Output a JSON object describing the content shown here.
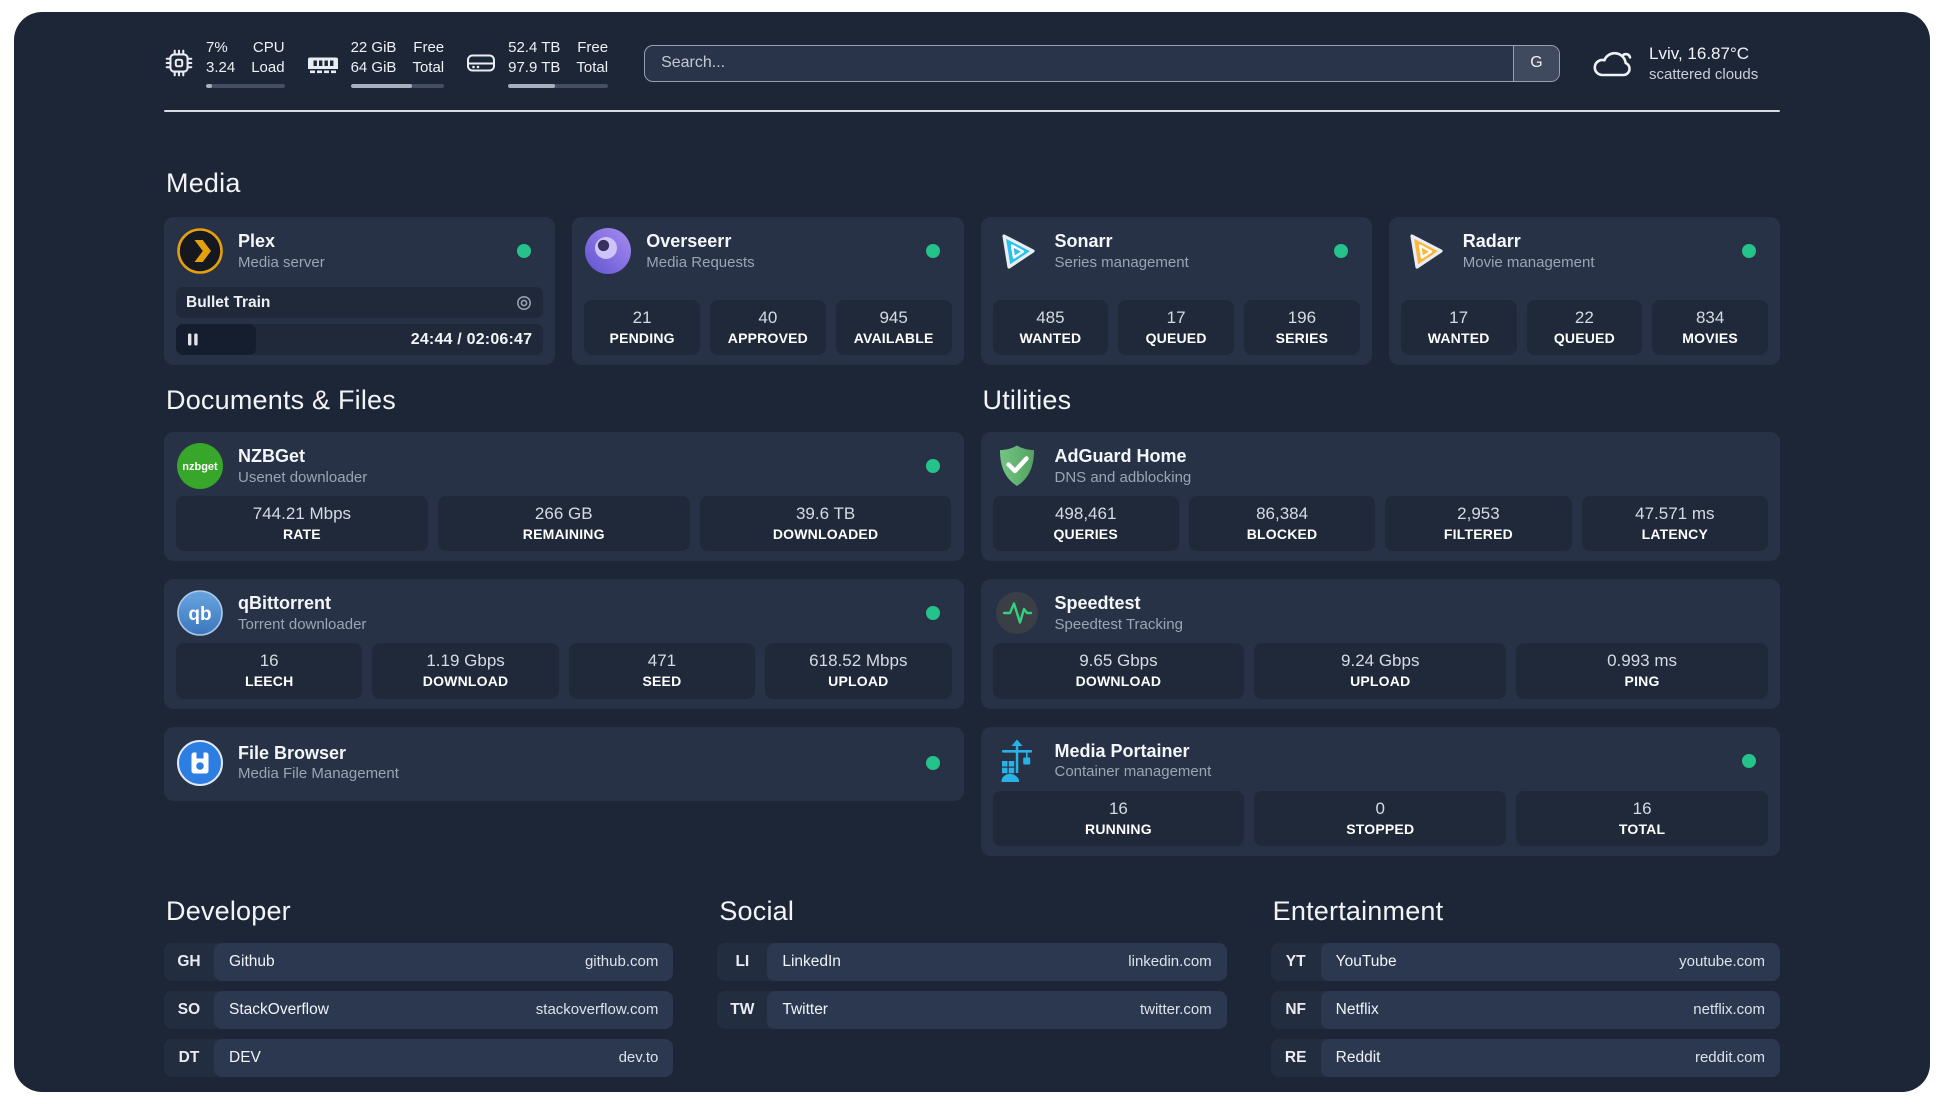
{
  "header": {
    "stats": [
      {
        "values": [
          "7%",
          "3.24"
        ],
        "labels": [
          "CPU",
          "Load"
        ],
        "progress": 8
      },
      {
        "values": [
          "22 GiB",
          "64 GiB"
        ],
        "labels": [
          "Free",
          "Total"
        ],
        "progress": 66
      },
      {
        "values": [
          "52.4 TB",
          "97.9 TB"
        ],
        "labels": [
          "Free",
          "Total"
        ],
        "progress": 47
      }
    ],
    "search": {
      "placeholder": "Search...",
      "button_label": "G"
    },
    "weather": {
      "title": "Lviv, 16.87°C",
      "subtitle": "scattered clouds"
    }
  },
  "status_color": "#25c38b",
  "sections": {
    "media": {
      "title": "Media",
      "plex": {
        "name": "Plex",
        "description": "Media server",
        "now_playing": "Bullet Train",
        "time": "24:44 / 02:06:47"
      },
      "overseerr": {
        "name": "Overseerr",
        "description": "Media Requests",
        "stats": [
          {
            "value": "21",
            "label": "PENDING"
          },
          {
            "value": "40",
            "label": "APPROVED"
          },
          {
            "value": "945",
            "label": "AVAILABLE"
          }
        ]
      },
      "sonarr": {
        "name": "Sonarr",
        "description": "Series management",
        "stats": [
          {
            "value": "485",
            "label": "WANTED"
          },
          {
            "value": "17",
            "label": "QUEUED"
          },
          {
            "value": "196",
            "label": "SERIES"
          }
        ]
      },
      "radarr": {
        "name": "Radarr",
        "description": "Movie management",
        "stats": [
          {
            "value": "17",
            "label": "WANTED"
          },
          {
            "value": "22",
            "label": "QUEUED"
          },
          {
            "value": "834",
            "label": "MOVIES"
          }
        ]
      }
    },
    "documents": {
      "title": "Documents & Files",
      "nzbget": {
        "name": "NZBGet",
        "description": "Usenet downloader",
        "stats": [
          {
            "value": "744.21 Mbps",
            "label": "RATE"
          },
          {
            "value": "266 GB",
            "label": "REMAINING"
          },
          {
            "value": "39.6 TB",
            "label": "DOWNLOADED"
          }
        ]
      },
      "qbittorrent": {
        "name": "qBittorrent",
        "description": "Torrent downloader",
        "stats": [
          {
            "value": "16",
            "label": "LEECH"
          },
          {
            "value": "1.19 Gbps",
            "label": "DOWNLOAD"
          },
          {
            "value": "471",
            "label": "SEED"
          },
          {
            "value": "618.52 Mbps",
            "label": "UPLOAD"
          }
        ]
      },
      "filebrowser": {
        "name": "File Browser",
        "description": "Media File Management"
      }
    },
    "utilities": {
      "title": "Utilities",
      "adguard": {
        "name": "AdGuard Home",
        "description": "DNS and adblocking",
        "stats": [
          {
            "value": "498,461",
            "label": "QUERIES"
          },
          {
            "value": "86,384",
            "label": "BLOCKED"
          },
          {
            "value": "2,953",
            "label": "FILTERED"
          },
          {
            "value": "47.571 ms",
            "label": "LATENCY"
          }
        ]
      },
      "speedtest": {
        "name": "Speedtest",
        "description": "Speedtest Tracking",
        "stats": [
          {
            "value": "9.65 Gbps",
            "label": "DOWNLOAD"
          },
          {
            "value": "9.24 Gbps",
            "label": "UPLOAD"
          },
          {
            "value": "0.993 ms",
            "label": "PING"
          }
        ]
      },
      "portainer": {
        "name": "Media Portainer",
        "description": "Container management",
        "stats": [
          {
            "value": "16",
            "label": "RUNNING"
          },
          {
            "value": "0",
            "label": "STOPPED"
          },
          {
            "value": "16",
            "label": "TOTAL"
          }
        ]
      }
    },
    "developer": {
      "title": "Developer",
      "links": [
        {
          "abbr": "GH",
          "name": "Github",
          "url": "github.com"
        },
        {
          "abbr": "SO",
          "name": "StackOverflow",
          "url": "stackoverflow.com"
        },
        {
          "abbr": "DT",
          "name": "DEV",
          "url": "dev.to"
        }
      ]
    },
    "social": {
      "title": "Social",
      "links": [
        {
          "abbr": "LI",
          "name": "LinkedIn",
          "url": "linkedin.com"
        },
        {
          "abbr": "TW",
          "name": "Twitter",
          "url": "twitter.com"
        }
      ]
    },
    "entertainment": {
      "title": "Entertainment",
      "links": [
        {
          "abbr": "YT",
          "name": "YouTube",
          "url": "youtube.com"
        },
        {
          "abbr": "NF",
          "name": "Netflix",
          "url": "netflix.com"
        },
        {
          "abbr": "RE",
          "name": "Reddit",
          "url": "reddit.com"
        }
      ]
    }
  }
}
